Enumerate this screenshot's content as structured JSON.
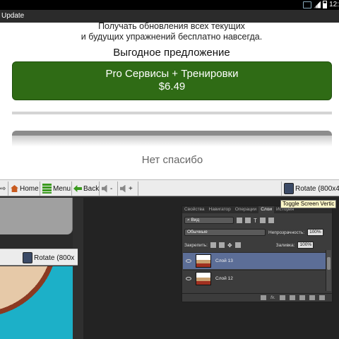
{
  "status_bar": {
    "clock": "12:"
  },
  "dialog": {
    "title": "Update",
    "description_line1": "Получать обновления всех текущих",
    "description_line2": "и будущих упражнений бесплатно навсегда.",
    "offer_heading": "Выгодное предложение",
    "buy_button_line1": "Pro Сервисы + Тренировки",
    "buy_button_line2": "$6.49",
    "no_thanks": "Нет спасибо"
  },
  "emulator_toolbar": {
    "home": "Home",
    "menu": "Menu",
    "back": "Back",
    "vol_down": "-",
    "vol_up": "+",
    "rotate": "Rotate (800x4",
    "tooltip": "Toggle Screen Vertic"
  },
  "mini_toolbar": {
    "rotate": "Rotate (800x"
  },
  "layers_panel": {
    "tabs": [
      "Свойства",
      "Навигатор",
      "Операции",
      "Слои",
      "История"
    ],
    "active_tab": "Слои",
    "kind_select": "Вид",
    "blend_mode": "Обычные",
    "opacity_label": "Непрозрачность:",
    "opacity_value": "100%",
    "lock_label": "Закрепить:",
    "fill_label": "Заливка:",
    "fill_value": "100%",
    "layers": [
      {
        "name": "Слой 13",
        "selected": true
      },
      {
        "name": "Слой 12",
        "selected": false
      }
    ],
    "footer_fx": "fx."
  },
  "colors": {
    "buy_button": "#2f6b15",
    "selected_layer": "#5c6e97",
    "photoshop_panel": "#3c3c3c"
  }
}
